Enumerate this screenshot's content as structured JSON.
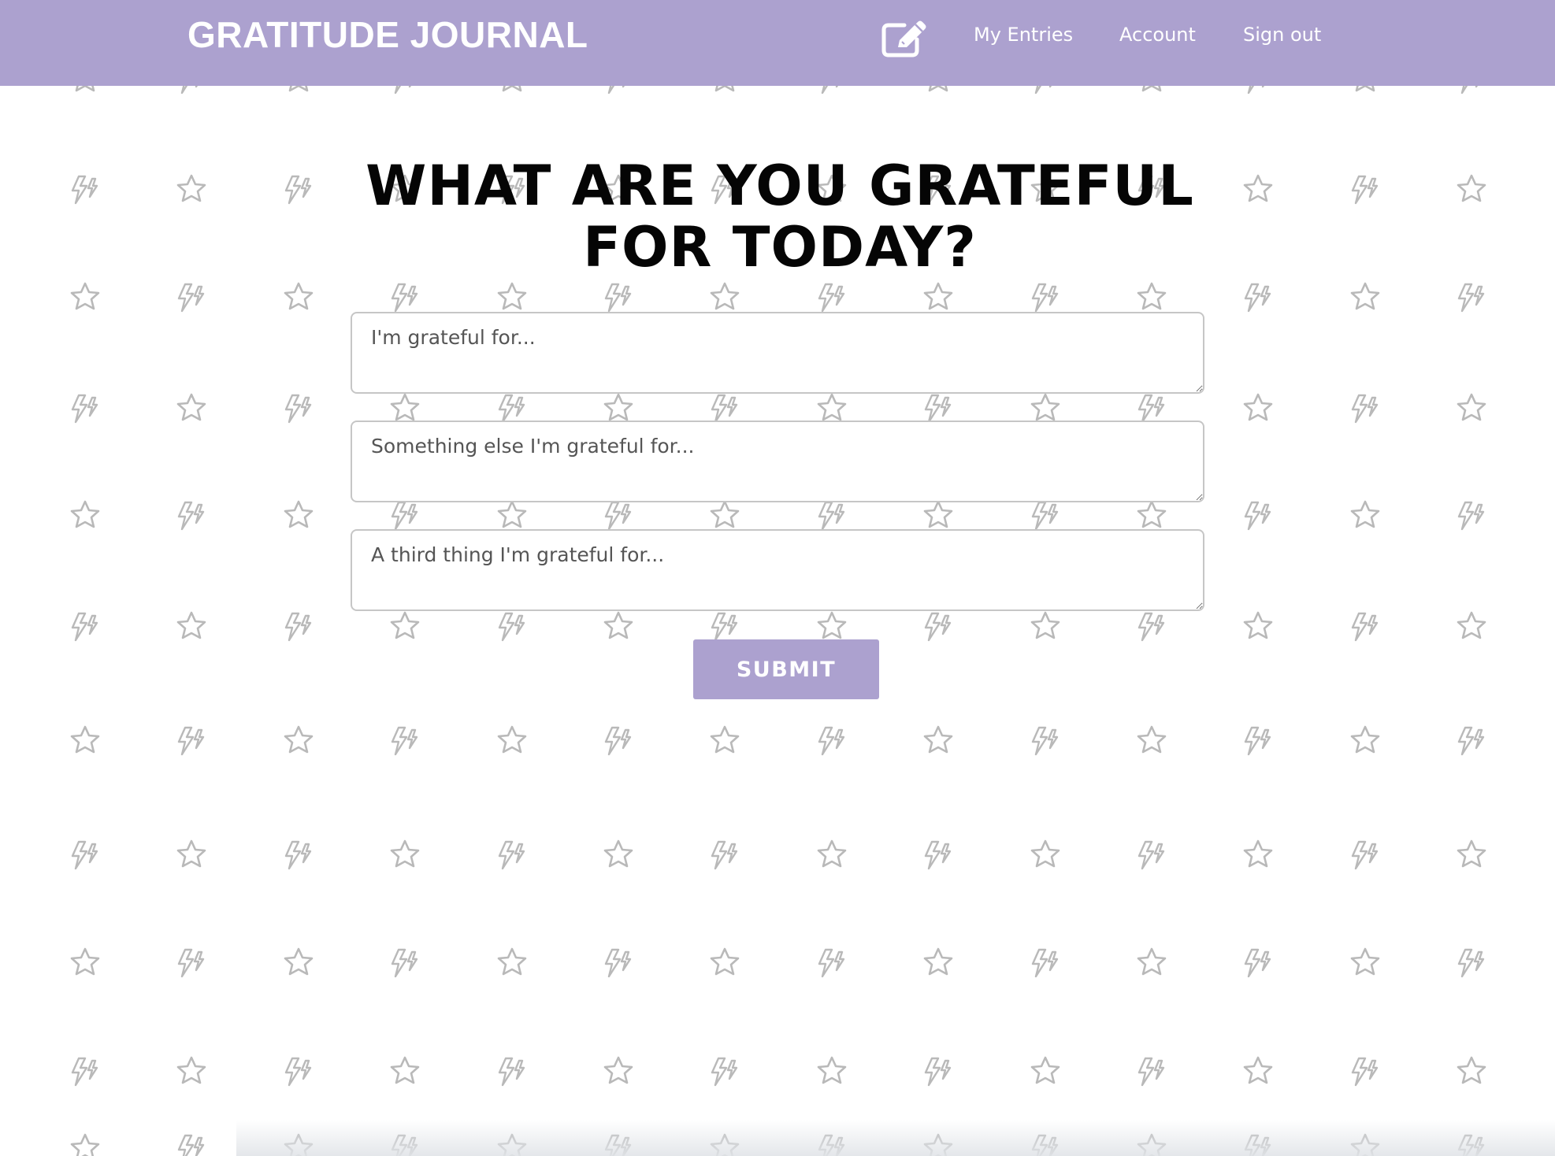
{
  "header": {
    "brand": "GRATITUDE JOURNAL",
    "compose_icon": "pencil-square-icon",
    "nav": {
      "my_entries": "My Entries",
      "account": "Account",
      "sign_out": "Sign out"
    },
    "background_color": "#aca1cf"
  },
  "main": {
    "heading": "WHAT ARE YOU GRATEFUL FOR TODAY?",
    "entries": [
      {
        "value": "",
        "placeholder": "I'm grateful for..."
      },
      {
        "value": "",
        "placeholder": "Something else I'm grateful for..."
      },
      {
        "value": "",
        "placeholder": "A third thing I'm grateful for..."
      }
    ],
    "submit_label": "SUBMIT"
  },
  "background": {
    "pattern_icons": [
      "star-icon",
      "lightning-icon"
    ],
    "pattern_color": "#b9b9b9"
  }
}
